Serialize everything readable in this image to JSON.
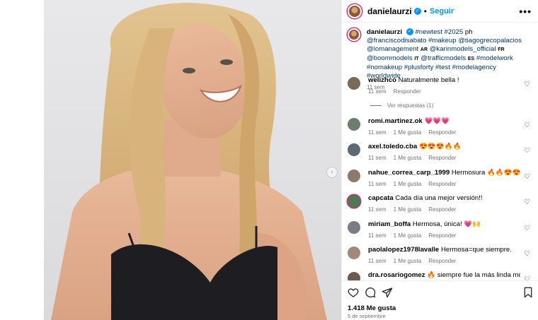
{
  "header": {
    "username": "danielaurzi",
    "follow_label": "Seguir",
    "more_label": "•••"
  },
  "caption": {
    "username": "danielaurzi",
    "text_start": "#newtest #2025",
    "ph": " ph ",
    "mentions_1": "@franciscodisabato #makeup @tiagogrecopalacios @lomanagement",
    "cc_ar": "AR",
    "mention_karin": "@karinmodels_official",
    "cc_fr": "FR",
    "mention_boom": "@boommodels",
    "cc_it": "IT",
    "mention_traffic": "@trafficmodels",
    "cc_es": "ES",
    "tags_end": "#modelwork #nomakeup #plusforty #test #modelagency #worldwide",
    "time": "11 sem"
  },
  "comments": [
    {
      "username": "welizhco",
      "text": "Naturalmente bella !",
      "time": "11 sem",
      "likes": "",
      "reply": "Responder",
      "avatar_color": "#7a6a58"
    },
    {
      "username": "romi.martinez.ok",
      "text": "💗💗💗",
      "time": "11 sem",
      "likes": "1 Me gusta",
      "reply": "Responder",
      "avatar_color": "#6b7f6e"
    },
    {
      "username": "axel.toledo.cba",
      "text": "😍😍😍🔥🔥",
      "time": "11 sem",
      "likes": "1 Me gusta",
      "reply": "Responder",
      "avatar_color": "#5e6a73"
    },
    {
      "username": "nahue_correa_carp_1999",
      "text": "Hermosura 🔥🔥😍😍",
      "time": "11 sem",
      "likes": "1 Me gusta",
      "reply": "Responder",
      "avatar_color": "#8c7b6b"
    },
    {
      "username": "capcata",
      "text": "Cada día una mejor versión!!",
      "time": "11 sem",
      "likes": "1 Me gusta",
      "reply": "Responder",
      "avatar_color": "#4d7a55"
    },
    {
      "username": "miriam_boffa",
      "text": "Hermosa, única! 💗🙌",
      "time": "11 sem",
      "likes": "1 Me gusta",
      "reply": "Responder",
      "avatar_color": "#7b7d84"
    },
    {
      "username": "paolalopez1978lavalle",
      "text": "Hermosa=que siempre.",
      "time": "11 sem",
      "likes": "1 Me gusta",
      "reply": "Responder",
      "avatar_color": "#a08a7a"
    },
    {
      "username": "dra.rosariogomez",
      "text": "🔥 siempre fue la más linda modelo",
      "time": "",
      "likes": "",
      "reply": "",
      "avatar_color": "#6e5a4c"
    }
  ],
  "view_replies": "Ver respuestas (1)",
  "footer": {
    "likes": "1.418 Me gusta",
    "date": "5 de septiembre"
  }
}
